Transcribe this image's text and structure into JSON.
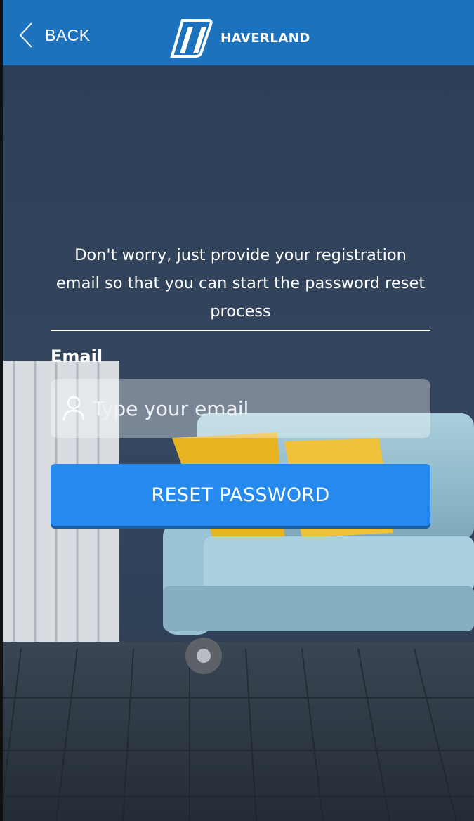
{
  "header": {
    "back_label": "BACK",
    "brand": "HAVERLAND",
    "background_color": "#1c72bd"
  },
  "form": {
    "description": "Don't worry, just provide your registration email so that you can start the password reset process",
    "email_label": "Email",
    "email_placeholder": "Type your email",
    "email_value": "",
    "submit_label": "RESET PASSWORD",
    "button_color": "#2589ee"
  },
  "icons": {
    "back": "chevron-left-icon",
    "logo": "haverland-logo-icon",
    "user": "user-icon"
  }
}
